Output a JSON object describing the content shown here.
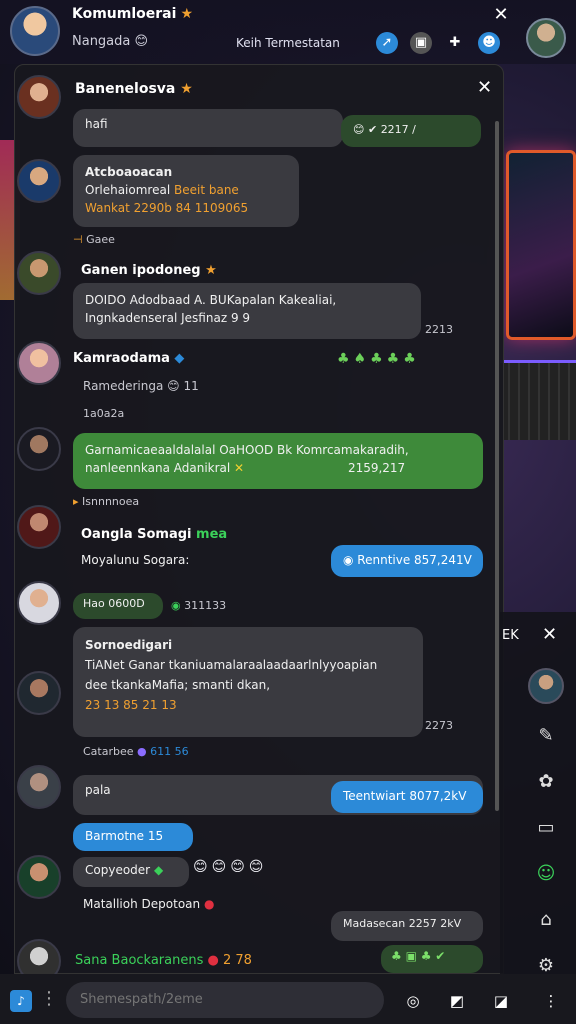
{
  "header": {
    "title": "Komumloerai",
    "subtitle": "Nangada",
    "center_text": "Keih Termestatan",
    "close_icon": "close-icon"
  },
  "panel": {
    "title": "Banenelosva",
    "close_icon": "close-icon"
  },
  "messages": [
    {
      "name": "",
      "bubble": "hafi",
      "right_bubble": "2217 /"
    },
    {
      "name": "Atcboaoacan",
      "line1": "Orlehaiomreal",
      "line1_accent": "Beeit bane",
      "line2": "Wankat 2290b 84 1109065",
      "meta": "Gaee"
    },
    {
      "name": "Ganen ipodoneg",
      "line1": "DOIDO Adodbaad A. BUKapalan Kakealiai,",
      "line2": "Ingnkadenseral Jesfinaz 9 9",
      "time": "2213"
    },
    {
      "name": "Kamraodama",
      "line1": "Ramederinga",
      "line1_count": "11",
      "meta": "1a0a2a"
    },
    {
      "name": "",
      "line1": "Garnamicaeaaldalalal OaHOOD Bk Komrcamakaradih,",
      "line2": "nanleennkana Adanikral",
      "time": "2159,217",
      "meta": "Isnnnnoea"
    },
    {
      "name": "Oangla Somagi",
      "name_accent": "mea",
      "line1": "Moyalunu Sogara:",
      "right_bubble": "Renntive 857,241V"
    },
    {
      "name": "",
      "bubble": "Hao 0600D",
      "meta": "311133"
    },
    {
      "name": "Sornoedigari",
      "line1": "TiANet Ganar tkaniuamalaraalaadaarlnlyyoapian",
      "line2": "dee tkankaMafia; smanti dkan,",
      "line3": "23 13 85 21 13",
      "time": "2273",
      "meta": "Catarbee",
      "meta_count": "611 56"
    },
    {
      "name": "",
      "bubble": "pala",
      "right_bubble": "Teentwiart 8077,2kV"
    },
    {
      "name": "",
      "bubble": "Barmotne",
      "bubble_count": "15",
      "line1": "Copyeoder",
      "line2": "Matallioh Depotoan",
      "right_bubble": "Madasecan 2257 2kV"
    },
    {
      "name": "Sana Baockaranens",
      "name_count": "2 78"
    }
  ],
  "side_panel": {
    "label": "EK"
  },
  "composer": {
    "placeholder": "Shemespath/2eme"
  }
}
